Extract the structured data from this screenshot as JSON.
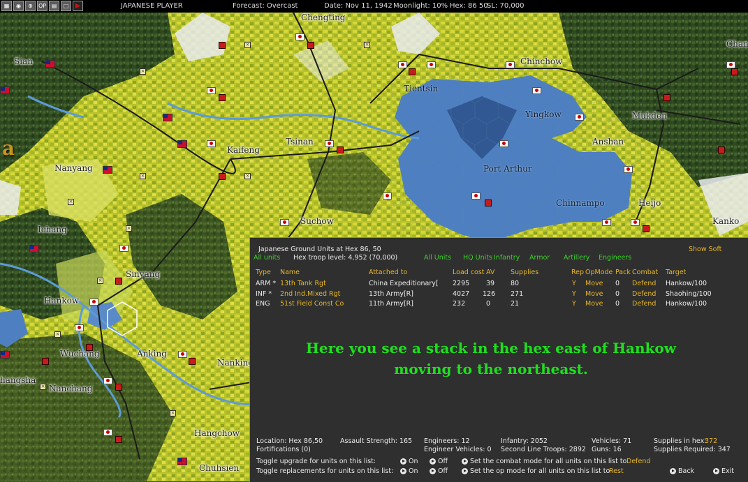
{
  "topbar": {
    "icons": [
      "map-icon",
      "globe-icon",
      "target-icon",
      "op-icon",
      "report-icon",
      "window-icon",
      "play-icon"
    ],
    "op_label": "OP",
    "player": "JAPANESE PLAYER",
    "forecast": "Forecast: Overcast",
    "date": "Date: Nov 11, 1942",
    "moonlight": "Moonlight: 10%",
    "hex": "Hex: 86 50",
    "sl": "SL: 70,000"
  },
  "map": {
    "cities": [
      "Chengting",
      "Sian",
      "Chinchow",
      "Tientsin",
      "Yingkow",
      "Mukden",
      "Kaifeng",
      "Tsinan",
      "Anshan",
      "Nanyang",
      "Port Arthur",
      "Chinnampo",
      "Heijo",
      "Ichang",
      "Suchow",
      "Kanko",
      "Sinyang",
      "Hankow",
      "Wuchang",
      "Anking",
      "Nanking",
      "Nanchang",
      "Hangchow",
      "Chuhsien",
      "Chan",
      "a",
      "hangsha"
    ]
  },
  "panel": {
    "title": "Japanese Ground Units at Hex 86, 50",
    "all_units": "All units",
    "troop_level": "Hex troop level: 4,952  (70,000)",
    "filters": [
      "All Units",
      "HQ Units",
      "Infantry",
      "Armor",
      "Artillery",
      "Engineers"
    ],
    "show_soft": "Show Soft",
    "columns": {
      "type": "Type",
      "name": "Name",
      "attached": "Attached to",
      "load": "Load cost",
      "av": "AV",
      "supplies": "Supplies",
      "rep": "Rep",
      "opmode": "OpMode",
      "pack": "Pack",
      "combat": "Combat",
      "target": "Target"
    },
    "units": [
      {
        "type": "ARM *",
        "name": "13th Tank Rgt",
        "attached": "China Expeditionary[",
        "load": "2295",
        "av": "39",
        "supplies": "80",
        "rep": "Y",
        "opmode": "Move",
        "pack": "0",
        "combat": "Defend",
        "target": "Hankow/100"
      },
      {
        "type": "INF *",
        "name": "2nd Ind.Mixed Rgt",
        "attached": "13th Army[R]",
        "load": "4027",
        "av": "126",
        "supplies": "271",
        "rep": "Y",
        "opmode": "Move",
        "pack": "0",
        "combat": "Defend",
        "target": "Shaohing/100"
      },
      {
        "type": "ENG",
        "name": "51st Field Const Co",
        "attached": "11th Army[R]",
        "load": "232",
        "av": "0",
        "supplies": "21",
        "rep": "Y",
        "opmode": "Move",
        "pack": "0",
        "combat": "Defend",
        "target": "Hankow/100"
      }
    ],
    "message_line1": "Here you see a stack in the hex east of Hankow",
    "message_line2": "moving to the northeast.",
    "stats": {
      "location": "Location: Hex 86,50",
      "fortifications": "Fortifications (0)",
      "assault": "Assault Strength: 165",
      "engineers": "Engineers: 12",
      "eng_vehicles": "Engineer Vehicles: 0",
      "infantry": "Infantry: 2052",
      "second_line": "Second Line Troops: 2892",
      "vehicles": "Vehicles: 71",
      "guns": "Guns: 16",
      "supplies_hex_label": "Supplies in hex:",
      "supplies_hex_value": "372",
      "supplies_req": "Supplies Required: 347"
    },
    "toggles": {
      "upgrade_label": "Toggle upgrade for units on this list:",
      "replace_label": "Toggle replacements for units on this list:",
      "on": "On",
      "off": "Off",
      "combat_mode_label": "Set the combat mode for all units on this list to",
      "combat_mode_value": "Defend",
      "op_mode_label": "Set the op mode for all units on this list to",
      "op_mode_value": "Rest"
    },
    "back": "Back",
    "exit": "Exit"
  }
}
